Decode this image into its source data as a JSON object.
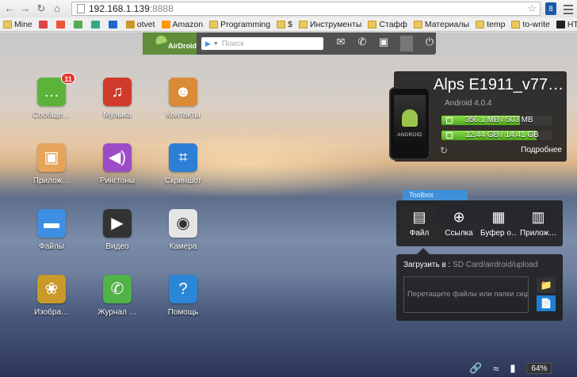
{
  "browser": {
    "url_host": "192.168.1.139",
    "url_port": ":8888",
    "extension_label": "8",
    "bookmarks": [
      {
        "label": "Mine",
        "kind": "folder"
      },
      {
        "label": "",
        "kind": "gmail"
      },
      {
        "label": "",
        "kind": "ext-red"
      },
      {
        "label": "",
        "kind": "ext-green"
      },
      {
        "label": "",
        "kind": "ext-swirl"
      },
      {
        "label": "",
        "kind": "ext-b"
      },
      {
        "label": "otvet",
        "kind": "flower"
      },
      {
        "label": "Amazon",
        "kind": "amazon"
      },
      {
        "label": "Programming",
        "kind": "folder"
      },
      {
        "label": "$",
        "kind": "folder"
      },
      {
        "label": "Инструменты",
        "kind": "folder"
      },
      {
        "label": "Стафф",
        "kind": "folder"
      },
      {
        "label": "Материалы",
        "kind": "folder"
      },
      {
        "label": "temp",
        "kind": "folder"
      },
      {
        "label": "to-write",
        "kind": "folder"
      },
      {
        "label": "HTG",
        "kind": "htg"
      }
    ]
  },
  "airdroid": {
    "logo_text": "AirDroid",
    "search_placeholder": "Поиск"
  },
  "apps": [
    {
      "label": "Сообще…",
      "icon": "message-icon",
      "color": "#5cb33a",
      "glyph": "…",
      "badge": "11"
    },
    {
      "label": "Музыка",
      "icon": "music-icon",
      "color": "#d03a2b",
      "glyph": "♫"
    },
    {
      "label": "Контакты",
      "icon": "contacts-icon",
      "color": "#d98b36",
      "glyph": "☻"
    },
    {
      "label": "Прилож…",
      "icon": "apps-icon",
      "color": "#e6a45a",
      "glyph": "▣"
    },
    {
      "label": "Рингтоны",
      "icon": "ringtone-icon",
      "color": "#9c4cc6",
      "glyph": "◀)"
    },
    {
      "label": "Скриншот",
      "icon": "screenshot-icon",
      "color": "#2c7fd4",
      "glyph": "⌗"
    },
    {
      "label": "Файлы",
      "icon": "files-icon",
      "color": "#3c8fe2",
      "glyph": "▬"
    },
    {
      "label": "Видео",
      "icon": "video-icon",
      "color": "#333333",
      "glyph": "▶"
    },
    {
      "label": "Камера",
      "icon": "camera-icon",
      "color": "#e5e5e5",
      "glyph": "◉"
    },
    {
      "label": "Изобра…",
      "icon": "images-icon",
      "color": "#c99a2a",
      "glyph": "❀"
    },
    {
      "label": "Журнал …",
      "icon": "calllog-icon",
      "color": "#4fb347",
      "glyph": "✆"
    },
    {
      "label": "Помощь",
      "icon": "help-icon",
      "color": "#2c86d6",
      "glyph": "?"
    }
  ],
  "device": {
    "name": "Alps E1911_v77…",
    "os": "Android 4.0.4",
    "storage1": "356.1 MB / 503 MB",
    "storage1_fraction": 0.71,
    "storage2": "12.44 GB / 14.41 GB",
    "storage2_fraction": 0.86,
    "details_label": "Подробнее",
    "phone_word": "ANDROID"
  },
  "toolbox": {
    "tab_label": "Toolbox",
    "tools": [
      {
        "label": "Файл",
        "icon": "file-icon",
        "glyph": "▤"
      },
      {
        "label": "Ссылка",
        "icon": "link-icon",
        "glyph": "⊕"
      },
      {
        "label": "Буфер о…",
        "icon": "clipboard-icon",
        "glyph": "▦"
      },
      {
        "label": "Прилож…",
        "icon": "app-install-icon",
        "glyph": "▥"
      }
    ],
    "upload_label": "Загрузить в :",
    "upload_path": "SD Card/airdroid/upload",
    "drop_text": "Перетащите файлы или папки сюда"
  },
  "status": {
    "battery": "64%"
  }
}
